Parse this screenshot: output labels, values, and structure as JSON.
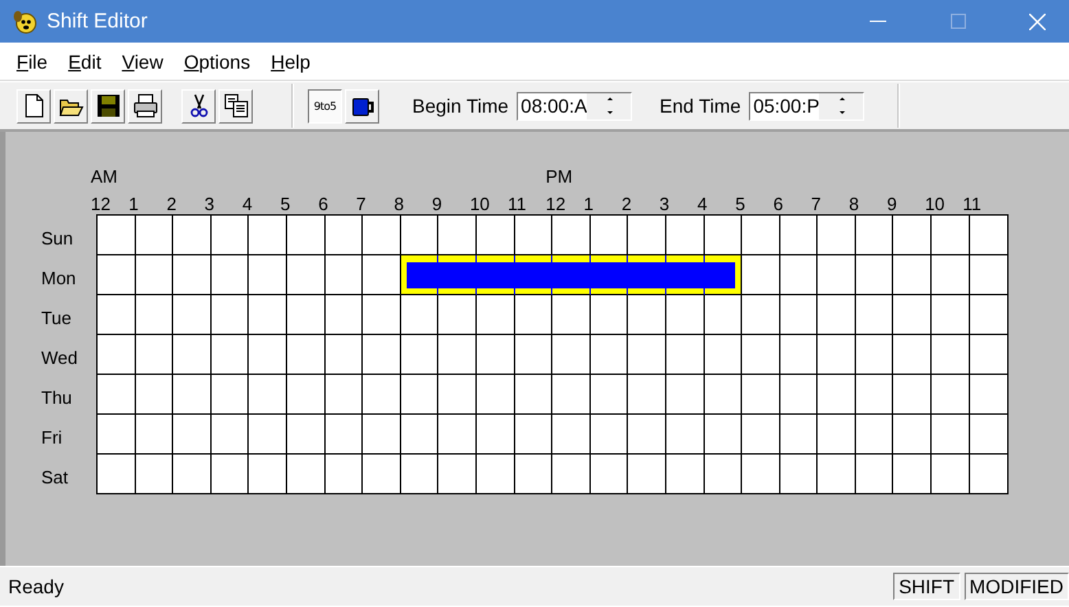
{
  "window": {
    "title": "Shift Editor"
  },
  "menu": [
    {
      "label": "File"
    },
    {
      "label": "Edit"
    },
    {
      "label": "View"
    },
    {
      "label": "Options"
    },
    {
      "label": "Help"
    }
  ],
  "toolbar": {
    "groups": [
      [
        {
          "kind": "new",
          "pressed": false
        },
        {
          "kind": "open",
          "pressed": false
        },
        {
          "kind": "save",
          "pressed": false
        },
        {
          "kind": "print",
          "pressed": false
        }
      ],
      [
        {
          "kind": "cut",
          "pressed": false
        },
        {
          "kind": "copy",
          "pressed": false
        }
      ],
      [
        {
          "kind": "nine-to-five",
          "label": "9to5",
          "pressed": true
        },
        {
          "kind": "mug",
          "pressed": false
        }
      ]
    ],
    "fields": [
      {
        "label": "Begin Time",
        "value": "08:00:A"
      },
      {
        "label": "End Time",
        "value": "05:00:P"
      }
    ]
  },
  "grid": {
    "periods": [
      {
        "label": "AM"
      },
      {
        "label": "PM"
      }
    ],
    "hours": [
      "12",
      "1",
      "2",
      "3",
      "4",
      "5",
      "6",
      "7",
      "8",
      "9",
      "10",
      "11",
      "12",
      "1",
      "2",
      "3",
      "4",
      "5",
      "6",
      "7",
      "8",
      "9",
      "10",
      "11"
    ],
    "days": [
      {
        "label": "Sun",
        "filled": [
          false,
          false,
          false,
          false,
          false,
          false,
          false,
          false,
          false,
          false,
          false,
          false,
          false,
          false,
          false,
          false,
          false,
          false,
          false,
          false,
          false,
          false,
          false,
          false
        ]
      },
      {
        "label": "Mon",
        "filled": [
          false,
          false,
          false,
          false,
          false,
          false,
          false,
          false,
          true,
          true,
          true,
          true,
          true,
          true,
          true,
          true,
          true,
          false,
          false,
          false,
          false,
          false,
          false,
          false
        ]
      },
      {
        "label": "Tue",
        "filled": [
          false,
          false,
          false,
          false,
          false,
          false,
          false,
          false,
          false,
          false,
          false,
          false,
          false,
          false,
          false,
          false,
          false,
          false,
          false,
          false,
          false,
          false,
          false,
          false
        ]
      },
      {
        "label": "Wed",
        "filled": [
          false,
          false,
          false,
          false,
          false,
          false,
          false,
          false,
          false,
          false,
          false,
          false,
          false,
          false,
          false,
          false,
          false,
          false,
          false,
          false,
          false,
          false,
          false,
          false
        ]
      },
      {
        "label": "Thu",
        "filled": [
          false,
          false,
          false,
          false,
          false,
          false,
          false,
          false,
          false,
          false,
          false,
          false,
          false,
          false,
          false,
          false,
          false,
          false,
          false,
          false,
          false,
          false,
          false,
          false
        ]
      },
      {
        "label": "Fri",
        "filled": [
          false,
          false,
          false,
          false,
          false,
          false,
          false,
          false,
          false,
          false,
          false,
          false,
          false,
          false,
          false,
          false,
          false,
          false,
          false,
          false,
          false,
          false,
          false,
          false
        ]
      },
      {
        "label": "Sat",
        "filled": [
          false,
          false,
          false,
          false,
          false,
          false,
          false,
          false,
          false,
          false,
          false,
          false,
          false,
          false,
          false,
          false,
          false,
          false,
          false,
          false,
          false,
          false,
          false,
          false
        ]
      }
    ]
  },
  "status_bar": {
    "message": "Ready",
    "panes": [
      "SHIFT",
      "MODIFIED"
    ]
  }
}
